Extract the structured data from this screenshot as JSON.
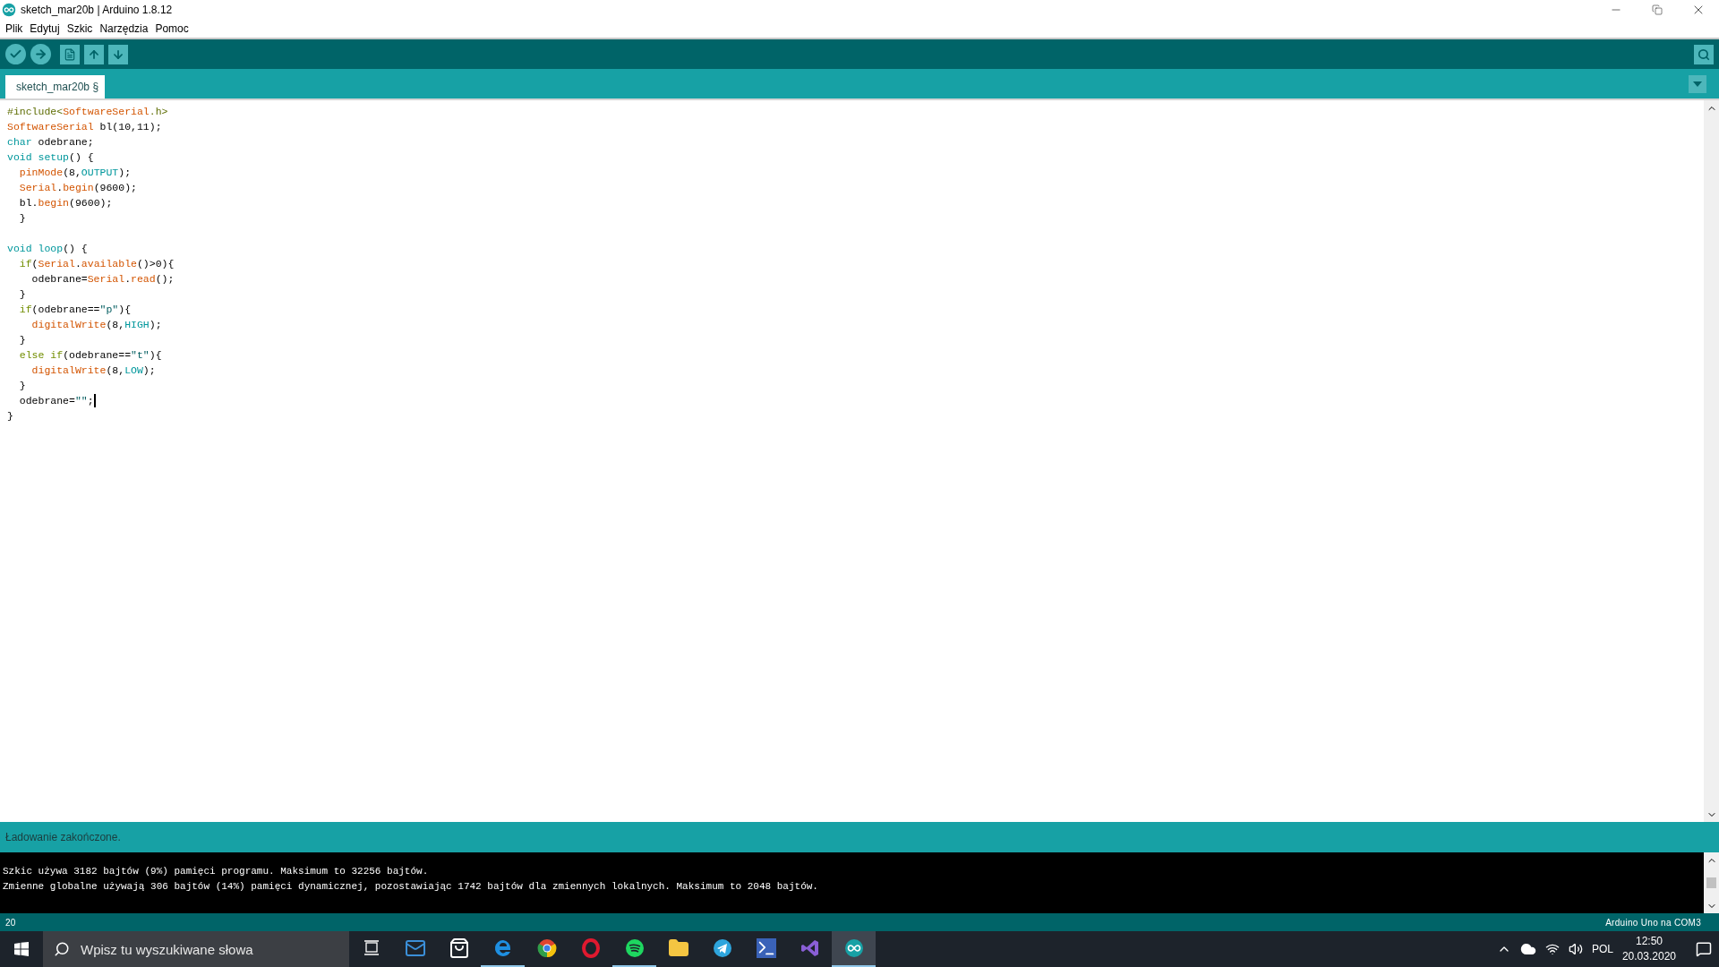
{
  "window": {
    "title": "sketch_mar20b | Arduino 1.8.12"
  },
  "menu": [
    "Plik",
    "Edytuj",
    "Szkic",
    "Narzędzia",
    "Pomoc"
  ],
  "tabs": [
    {
      "label": "sketch_mar20b §",
      "selected": true
    }
  ],
  "editor": {
    "lines": [
      {
        "caret": false,
        "gap_before": false,
        "tokens": [
          {
            "text": "#include<",
            "kind": "directive"
          },
          {
            "text": "SoftwareSerial",
            "kind": "type"
          },
          {
            "text": ".h>",
            "kind": "directive"
          }
        ]
      },
      {
        "caret": false,
        "gap_before": false,
        "tokens": [
          {
            "text": "SoftwareSerial",
            "kind": "type"
          },
          {
            "text": " bl(10,11);",
            "kind": "plain"
          }
        ]
      },
      {
        "caret": false,
        "gap_before": false,
        "tokens": [
          {
            "text": "char",
            "kind": "keyword"
          },
          {
            "text": " odebrane;",
            "kind": "plain"
          }
        ]
      },
      {
        "caret": false,
        "gap_before": false,
        "tokens": [
          {
            "text": "void ",
            "kind": "keyword"
          },
          {
            "text": "setup",
            "kind": "keyword"
          },
          {
            "text": "() {",
            "kind": "plain"
          }
        ]
      },
      {
        "caret": false,
        "gap_before": false,
        "tokens": [
          {
            "text": "  pinMode",
            "kind": "type"
          },
          {
            "text": "(8,",
            "kind": "plain"
          },
          {
            "text": "OUTPUT",
            "kind": "keyword"
          },
          {
            "text": ");",
            "kind": "plain"
          }
        ]
      },
      {
        "caret": false,
        "gap_before": false,
        "tokens": [
          {
            "text": "  Serial",
            "kind": "type"
          },
          {
            "text": ".",
            "kind": "plain"
          },
          {
            "text": "begin",
            "kind": "type"
          },
          {
            "text": "(9600);",
            "kind": "plain"
          }
        ]
      },
      {
        "caret": false,
        "gap_before": false,
        "tokens": [
          {
            "text": "  bl.",
            "kind": "plain"
          },
          {
            "text": "begin",
            "kind": "type"
          },
          {
            "text": "(9600);",
            "kind": "plain"
          }
        ]
      },
      {
        "caret": false,
        "gap_before": false,
        "tokens": [
          {
            "text": "  }",
            "kind": "plain"
          }
        ]
      },
      {
        "caret": false,
        "gap_before": true,
        "tokens": [
          {
            "text": "void ",
            "kind": "keyword"
          },
          {
            "text": "loop",
            "kind": "keyword"
          },
          {
            "text": "() {",
            "kind": "plain"
          }
        ]
      },
      {
        "caret": false,
        "gap_before": false,
        "tokens": [
          {
            "text": "  if",
            "kind": "control"
          },
          {
            "text": "(",
            "kind": "plain"
          },
          {
            "text": "Serial",
            "kind": "type"
          },
          {
            "text": ".",
            "kind": "plain"
          },
          {
            "text": "available",
            "kind": "type"
          },
          {
            "text": "()>0){",
            "kind": "plain"
          }
        ]
      },
      {
        "caret": false,
        "gap_before": false,
        "tokens": [
          {
            "text": "    odebrane=",
            "kind": "plain"
          },
          {
            "text": "Serial",
            "kind": "type"
          },
          {
            "text": ".",
            "kind": "plain"
          },
          {
            "text": "read",
            "kind": "type"
          },
          {
            "text": "();",
            "kind": "plain"
          }
        ]
      },
      {
        "caret": false,
        "gap_before": false,
        "tokens": [
          {
            "text": "  }",
            "kind": "plain"
          }
        ]
      },
      {
        "caret": false,
        "gap_before": false,
        "tokens": [
          {
            "text": "  if",
            "kind": "control"
          },
          {
            "text": "(odebrane==",
            "kind": "plain"
          },
          {
            "text": "\"p\"",
            "kind": "string"
          },
          {
            "text": "){",
            "kind": "plain"
          }
        ]
      },
      {
        "caret": false,
        "gap_before": false,
        "tokens": [
          {
            "text": "    digitalWrite",
            "kind": "type"
          },
          {
            "text": "(8,",
            "kind": "plain"
          },
          {
            "text": "HIGH",
            "kind": "keyword"
          },
          {
            "text": ");",
            "kind": "plain"
          }
        ]
      },
      {
        "caret": false,
        "gap_before": false,
        "tokens": [
          {
            "text": "  }",
            "kind": "plain"
          }
        ]
      },
      {
        "caret": false,
        "gap_before": false,
        "tokens": [
          {
            "text": "  else if",
            "kind": "control"
          },
          {
            "text": "(odebrane==",
            "kind": "plain"
          },
          {
            "text": "\"t\"",
            "kind": "string"
          },
          {
            "text": "){",
            "kind": "plain"
          }
        ]
      },
      {
        "caret": false,
        "gap_before": false,
        "tokens": [
          {
            "text": "    digitalWrite",
            "kind": "type"
          },
          {
            "text": "(8,",
            "kind": "plain"
          },
          {
            "text": "LOW",
            "kind": "keyword"
          },
          {
            "text": ");",
            "kind": "plain"
          }
        ]
      },
      {
        "caret": false,
        "gap_before": false,
        "tokens": [
          {
            "text": "  }",
            "kind": "plain"
          }
        ]
      },
      {
        "caret": true,
        "gap_before": false,
        "tokens": [
          {
            "text": "  odebrane=",
            "kind": "plain"
          },
          {
            "text": "\"\"",
            "kind": "string"
          },
          {
            "text": ";",
            "kind": "plain"
          }
        ]
      },
      {
        "caret": false,
        "gap_before": false,
        "tokens": [
          {
            "text": "}",
            "kind": "plain"
          }
        ]
      }
    ]
  },
  "status_message": "Ładowanie zakończone.",
  "console": [
    "Szkic używa 3182 bajtów (9%) pamięci programu. Maksimum to 32256 bajtów.",
    "Zmienne globalne używają 306 bajtów (14%) pamięci dynamicznej, pozostawiając 1742 bajtów dla zmiennych lokalnych. Maksimum to 2048 bajtów."
  ],
  "status_bar": {
    "line": "20",
    "board": "Arduino Uno na COM3"
  },
  "taskbar": {
    "search": {
      "placeholder": "Wpisz tu wyszukiwane słowa"
    },
    "apps": [
      {
        "kind": "mail",
        "running": false,
        "selected": false
      },
      {
        "kind": "store",
        "running": false,
        "selected": false
      },
      {
        "kind": "edge",
        "running": true,
        "selected": false
      },
      {
        "kind": "chrome",
        "running": false,
        "selected": false
      },
      {
        "kind": "opera",
        "running": false,
        "selected": false
      },
      {
        "kind": "spotify",
        "running": true,
        "selected": false
      },
      {
        "kind": "explorer",
        "running": false,
        "selected": false
      },
      {
        "kind": "telegram",
        "running": false,
        "selected": false
      },
      {
        "kind": "powershell",
        "running": false,
        "selected": false
      },
      {
        "kind": "studio",
        "running": false,
        "selected": false
      },
      {
        "kind": "arduino",
        "running": true,
        "selected": true
      }
    ],
    "language": "POL",
    "time": "12:50",
    "date": "20.03.2020"
  }
}
